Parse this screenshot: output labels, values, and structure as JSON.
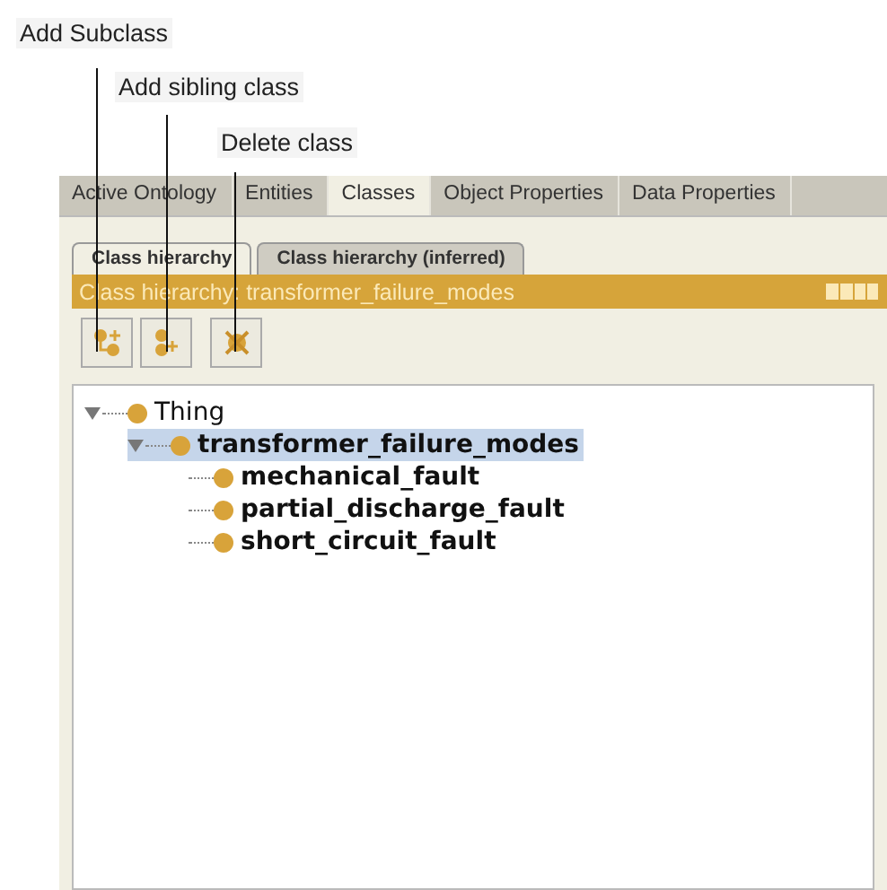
{
  "annotations": [
    {
      "text": "Add Subclass"
    },
    {
      "text": "Add sibling class"
    },
    {
      "text": "Delete class"
    }
  ],
  "main_tabs": [
    {
      "label": "Active Ontology",
      "selected": false
    },
    {
      "label": "Entities",
      "selected": false
    },
    {
      "label": "Classes",
      "selected": true
    },
    {
      "label": "Object Properties",
      "selected": false
    },
    {
      "label": "Data Properties",
      "selected": false
    }
  ],
  "view_tabs": [
    {
      "label": "Class hierarchy",
      "selected": true
    },
    {
      "label": "Class hierarchy (inferred)",
      "selected": false
    }
  ],
  "view_title": "Class hierarchy: transformer_failure_modes",
  "toolbar": [
    {
      "kind": "add-subclass"
    },
    {
      "kind": "add-sibling"
    },
    {
      "kind": "delete"
    }
  ],
  "tree": [
    {
      "label": "Thing",
      "bold": false,
      "selected": false,
      "expanded": true,
      "children": [
        {
          "label": "transformer_failure_modes",
          "bold": true,
          "selected": true,
          "expanded": true,
          "children": [
            {
              "label": "mechanical_fault",
              "bold": true,
              "selected": false
            },
            {
              "label": "partial_discharge_fault",
              "bold": true,
              "selected": false
            },
            {
              "label": "short_circuit_fault",
              "bold": true,
              "selected": false
            }
          ]
        }
      ]
    }
  ]
}
